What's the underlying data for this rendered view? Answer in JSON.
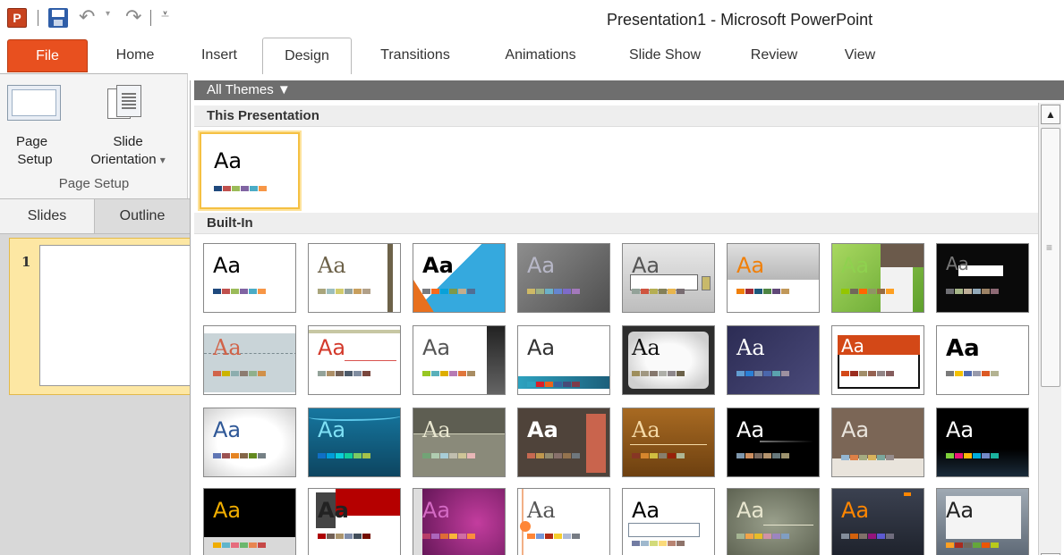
{
  "window": {
    "title": "Presentation1  -  Microsoft PowerPoint",
    "app_logo_letter": "P"
  },
  "quick_access": {
    "icons": [
      "powerpoint-logo-icon",
      "save-icon",
      "undo-icon",
      "redo-icon",
      "customize-quick-access-icon"
    ]
  },
  "tabs": [
    {
      "label": "File"
    },
    {
      "label": "Home"
    },
    {
      "label": "Insert"
    },
    {
      "label": "Design",
      "active": true
    },
    {
      "label": "Transitions"
    },
    {
      "label": "Animations"
    },
    {
      "label": "Slide Show"
    },
    {
      "label": "Review"
    },
    {
      "label": "View"
    }
  ],
  "ribbon": {
    "page_setup_line1": "Page",
    "page_setup_line2": "Setup",
    "orientation_line1": "Slide",
    "orientation_line2": "Orientation",
    "dropdown_glyph": "▾",
    "group_label": "Page Setup"
  },
  "pane": {
    "tab_slides": "Slides",
    "tab_outline": "Outline",
    "slide_number": "1"
  },
  "gallery": {
    "header": "All Themes ▼",
    "section_this": "This Presentation",
    "section_builtin": "Built-In",
    "tile_text": "Aa",
    "scroll_up_glyph": "▲",
    "scroll_down_glyph": "▼",
    "grip_glyph": "≡",
    "colors": {
      "accent_file_tab": "#e8501f",
      "selection": "#f5c042",
      "header_bar": "#6e6e6e"
    }
  }
}
